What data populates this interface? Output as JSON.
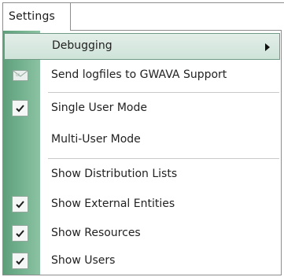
{
  "menu": {
    "title": "Settings"
  },
  "items": {
    "debugging": {
      "label": "Debugging"
    },
    "send_logfiles": {
      "label": "Send logfiles to GWAVA Support"
    },
    "single_user": {
      "label": "Single User Mode",
      "checked": true
    },
    "multi_user": {
      "label": "Multi-User Mode",
      "checked": false
    },
    "show_distribution_lists": {
      "label": "Show Distribution Lists",
      "checked": false
    },
    "show_external_entities": {
      "label": "Show External Entities",
      "checked": true
    },
    "show_resources": {
      "label": "Show Resources",
      "checked": true
    },
    "show_users": {
      "label": "Show Users",
      "checked": true
    }
  },
  "icons": {
    "submenu": "chevron-right-icon",
    "send": "envelope-icon",
    "check": "checkmark-icon"
  },
  "colors": {
    "gutter": "#74b28f",
    "highlight": "#d6e8df",
    "highlight_border": "#6f9a86",
    "border": "#8d8d8d"
  }
}
